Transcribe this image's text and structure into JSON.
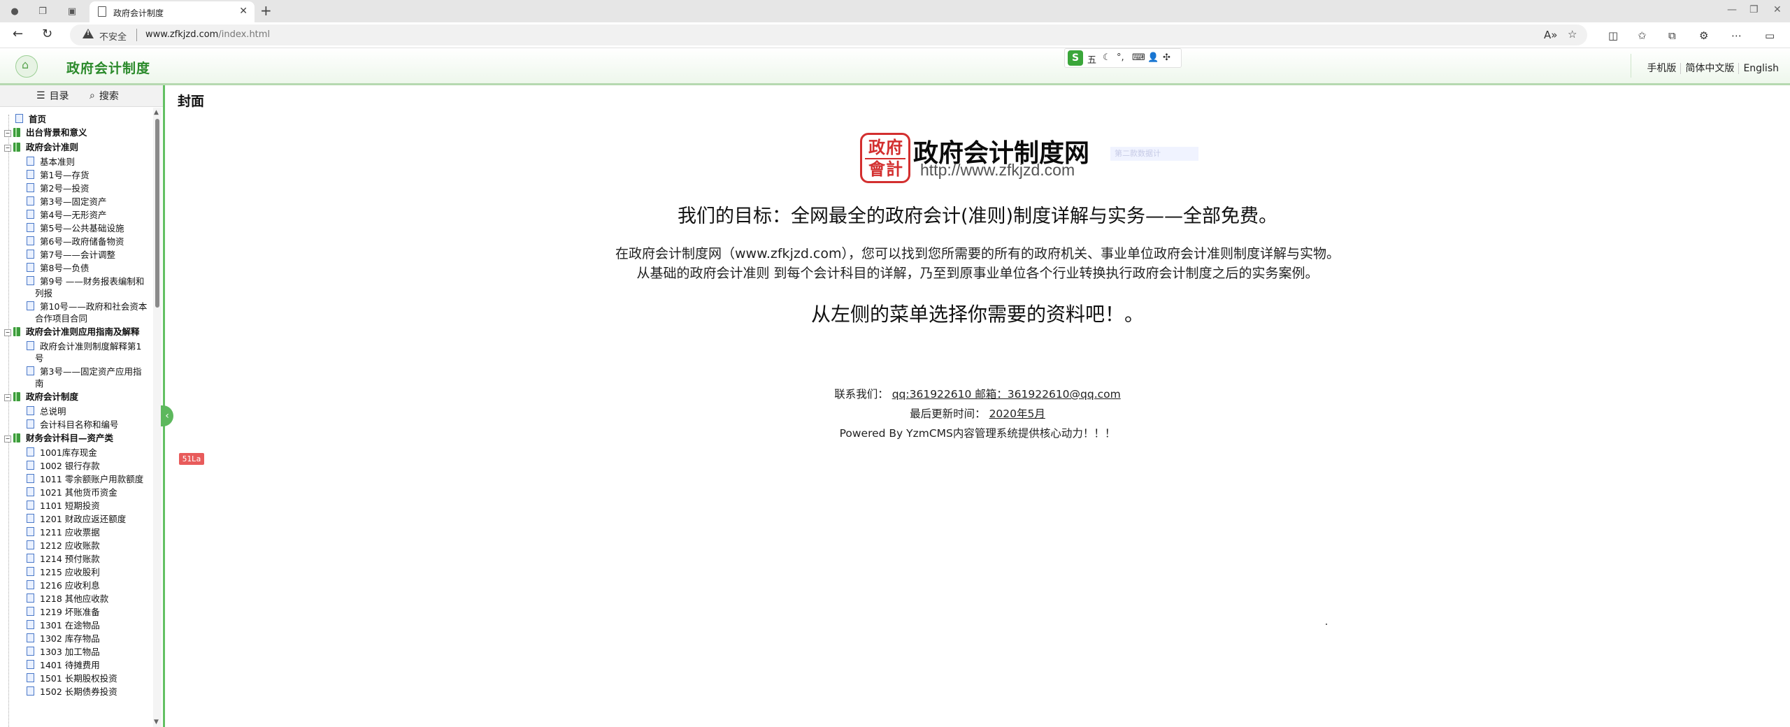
{
  "browser": {
    "tab_title": "政府会计制度",
    "url_host": "www.zfkjzd.com",
    "url_path": "/index.html",
    "security_label": "不安全"
  },
  "header": {
    "site_title": "政府会计制度",
    "ime_glyph": "S",
    "ime_mode": "五",
    "right_links": [
      "手机版",
      "简体中文版",
      "English"
    ]
  },
  "sidebar": {
    "tab_catalog": "目录",
    "tab_search": "搜索",
    "tree": [
      {
        "label": "首页",
        "level": 0,
        "kind": "page"
      },
      {
        "label": "出台背景和意义",
        "level": 0,
        "kind": "book"
      },
      {
        "label": "政府会计准则",
        "level": 0,
        "kind": "book"
      },
      {
        "label": "基本准则",
        "level": 1,
        "kind": "page"
      },
      {
        "label": "第1号—存货",
        "level": 1,
        "kind": "page"
      },
      {
        "label": "第2号—投资",
        "level": 1,
        "kind": "page"
      },
      {
        "label": "第3号—固定资产",
        "level": 1,
        "kind": "page"
      },
      {
        "label": "第4号—无形资产",
        "level": 1,
        "kind": "page"
      },
      {
        "label": "第5号—公共基础设施",
        "level": 1,
        "kind": "page"
      },
      {
        "label": "第6号—政府储备物资",
        "level": 1,
        "kind": "page"
      },
      {
        "label": "第7号——会计调整",
        "level": 1,
        "kind": "page"
      },
      {
        "label": "第8号—负债",
        "level": 1,
        "kind": "page"
      },
      {
        "label": "第9号 ——财务报表编制和",
        "cont": "列报",
        "level": 1,
        "kind": "page"
      },
      {
        "label": "第10号——政府和社会资本",
        "cont": "合作项目合同",
        "level": 1,
        "kind": "page"
      },
      {
        "label": "政府会计准则应用指南及解释",
        "level": 0,
        "kind": "book"
      },
      {
        "label": "政府会计准则制度解释第1",
        "cont": "号",
        "level": 1,
        "kind": "page"
      },
      {
        "label": "第3号——固定资产应用指",
        "cont": "南",
        "level": 1,
        "kind": "page"
      },
      {
        "label": "政府会计制度",
        "level": 0,
        "kind": "book"
      },
      {
        "label": "总说明",
        "level": 1,
        "kind": "page"
      },
      {
        "label": "会计科目名称和编号",
        "level": 1,
        "kind": "page"
      },
      {
        "label": "财务会计科目—资产类",
        "level": 0,
        "kind": "book"
      },
      {
        "label": "1001库存现金",
        "level": 1,
        "kind": "page"
      },
      {
        "label": "1002 银行存款",
        "level": 1,
        "kind": "page"
      },
      {
        "label": "1011 零余额账户用款额度",
        "level": 1,
        "kind": "page"
      },
      {
        "label": "1021 其他货币资金",
        "level": 1,
        "kind": "page"
      },
      {
        "label": "1101 短期投资",
        "level": 1,
        "kind": "page"
      },
      {
        "label": "1201 财政应返还额度",
        "level": 1,
        "kind": "page"
      },
      {
        "label": "1211 应收票据",
        "level": 1,
        "kind": "page"
      },
      {
        "label": "1212 应收账款",
        "level": 1,
        "kind": "page"
      },
      {
        "label": "1214 预付账款",
        "level": 1,
        "kind": "page"
      },
      {
        "label": "1215 应收股利",
        "level": 1,
        "kind": "page"
      },
      {
        "label": "1216 应收利息",
        "level": 1,
        "kind": "page"
      },
      {
        "label": "1218 其他应收款",
        "level": 1,
        "kind": "page"
      },
      {
        "label": "1219 坏账准备",
        "level": 1,
        "kind": "page"
      },
      {
        "label": "1301 在途物品",
        "level": 1,
        "kind": "page"
      },
      {
        "label": "1302 库存物品",
        "level": 1,
        "kind": "page"
      },
      {
        "label": "1303 加工物品",
        "level": 1,
        "kind": "page"
      },
      {
        "label": "1401 待摊费用",
        "level": 1,
        "kind": "page"
      },
      {
        "label": "1501 长期股权投资",
        "level": 1,
        "kind": "page"
      },
      {
        "label": "1502 长期债券投资",
        "level": 1,
        "kind": "page"
      }
    ]
  },
  "main": {
    "heading": "封面",
    "logo_seal_top": "政府",
    "logo_seal_bottom": "會計",
    "logo_name": "政府会计制度网",
    "logo_url": "http://www.zfkjzd.com",
    "logo_ghost": "第二款数据计",
    "goal": "我们的目标：全网最全的政府会计(准则)制度详解与实务——全部免费。",
    "intro1": "在政府会计制度网（www.zfkjzd.com），您可以找到您所需要的所有的政府机关、事业单位政府会计准则制度详解与实物。",
    "intro2": "从基础的政府会计准则 到每个会计科目的详解，乃至到原事业单位各个行业转换执行政府会计制度之后的实务案例。",
    "choose": "从左侧的菜单选择你需要的资料吧！。",
    "contact_label": "联系我们：",
    "contact_value": "qq:361922610 邮箱：361922610@qq.com",
    "updated_label": "最后更新时间：",
    "updated_value": "2020年5月",
    "powered": "Powered By YzmCMS内容管理系统提供核心动力！！！",
    "badge": "51La"
  }
}
